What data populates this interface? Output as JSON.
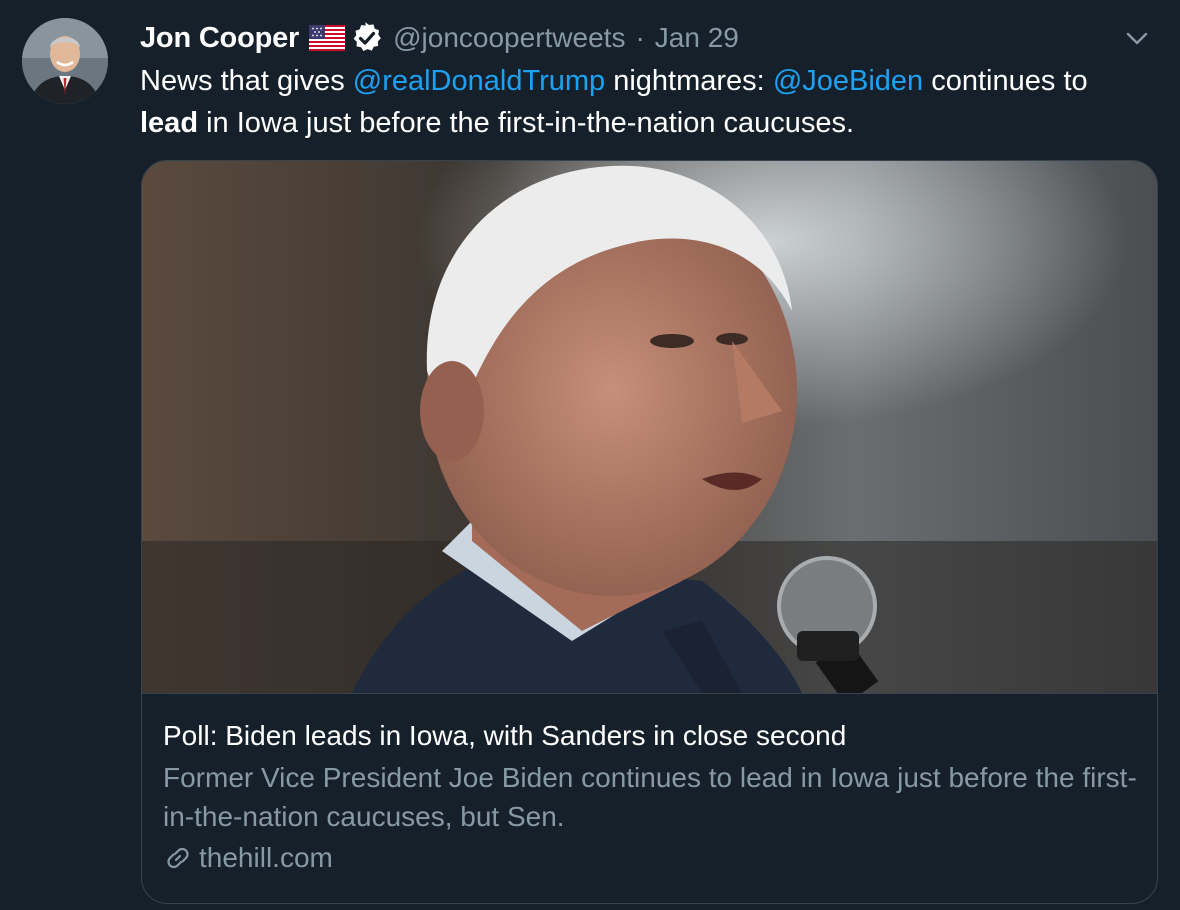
{
  "tweet": {
    "author_name": "Jon Cooper",
    "handle": "@joncoopertweets",
    "separator": "·",
    "date": "Jan 29",
    "text": {
      "part1": "News that gives ",
      "mention1": "@realDonaldTrump",
      "part2": " nightmares: ",
      "mention2": "@JoeBiden",
      "part3": " continues to ",
      "bold": "lead",
      "part4": " in Iowa just before the first-in-the-nation caucuses."
    }
  },
  "card": {
    "title": "Poll: Biden leads in Iowa, with Sanders in close second",
    "description": "Former Vice President Joe Biden continues to lead in Iowa just before the first-in-the-nation caucuses, but Sen.",
    "domain": "thehill.com"
  },
  "icons": {
    "flag": "us-flag-icon",
    "verified": "verified-badge-icon",
    "menu": "chevron-down-icon",
    "link": "link-icon"
  },
  "colors": {
    "background": "#15202b",
    "accent": "#1da1f2",
    "secondary_text": "#8899a6",
    "border": "#38444d"
  }
}
